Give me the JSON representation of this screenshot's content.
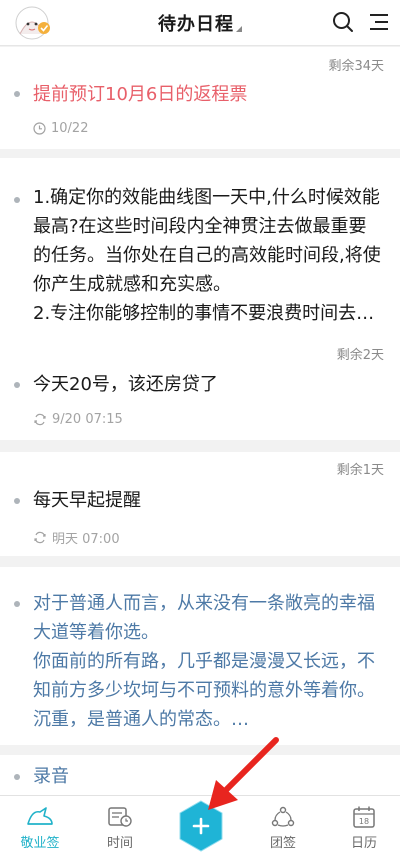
{
  "header": {
    "title": "待办日程",
    "avatar_icon": "avatar-icon",
    "search_icon": "search-icon",
    "menu_icon": "menu-icon"
  },
  "items": [
    {
      "remaining": "剩余34天",
      "text": "提前预订10月6日的返程票",
      "date": "10/22",
      "date_icon": "clock-icon",
      "color": "#e8606a"
    },
    {
      "remaining": "",
      "text": "1.确定你的效能曲线图一天中,什么时候效能最高?在这些时间段内全神贯注去做最重要的任务。当你处在自己的高效能时间段,将使你产生成就感和充实感。\n2.专注你能够控制的事情不要浪费时间去…",
      "date": "",
      "color": "#1a1a1a"
    },
    {
      "remaining": "剩余2天",
      "text": "今天20号，该还房贷了",
      "date": "9/20 07:15",
      "date_icon": "repeat-icon",
      "color": "#1a1a1a"
    },
    {
      "remaining": "剩余1天",
      "text": "每天早起提醒",
      "date": "明天 07:00",
      "date_icon": "repeat-icon",
      "color": "#1a1a1a"
    },
    {
      "remaining": "",
      "text": "对于普通人而言，从来没有一条敞亮的幸福大道等着你选。\n你面前的所有路，几乎都是漫漫又长远，不知前方多少坎坷与不可预料的意外等着你。\n沉重，是普通人的常态。…",
      "date": "",
      "color": "#4d79a6"
    },
    {
      "remaining": "",
      "text": "录音",
      "date": "",
      "color": "#4d79a6"
    }
  ],
  "tabs": [
    {
      "label": "敬业签",
      "icon": "note-icon",
      "active": true
    },
    {
      "label": "时间",
      "icon": "time-icon",
      "active": false
    },
    {
      "label": "团签",
      "icon": "team-icon",
      "active": false
    },
    {
      "label": "日历",
      "icon": "calendar-icon",
      "active": false,
      "badge": "18"
    }
  ],
  "add_button_icon": "plus-icon",
  "colors": {
    "accent": "#21b2c9",
    "add_button": "#1fb4d6",
    "arrow": "#e8251f",
    "red_text": "#e8606a",
    "blue_text": "#4d79a6"
  }
}
